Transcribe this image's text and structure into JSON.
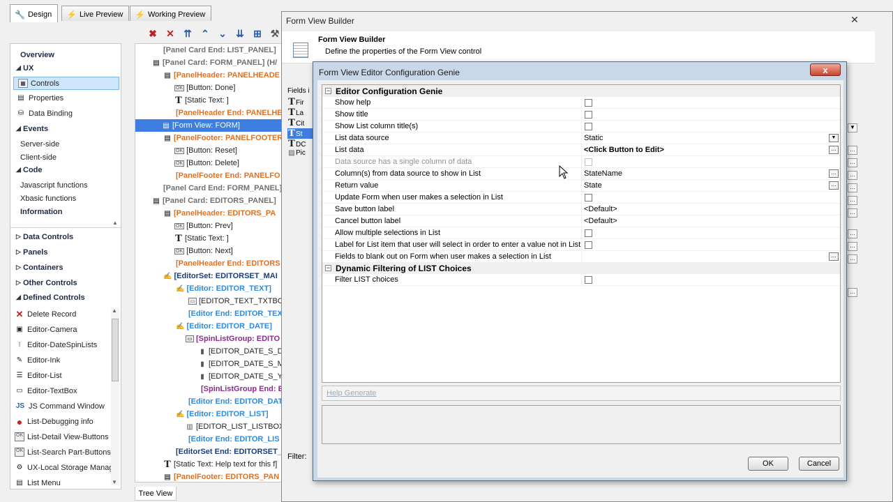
{
  "tabs": [
    {
      "label": "Design",
      "icon": "wrench-icon",
      "active": true
    },
    {
      "label": "Live Preview",
      "icon": "lightning-icon",
      "active": false
    },
    {
      "label": "Working Preview",
      "icon": "lightning-icon",
      "active": false
    }
  ],
  "toolbar": {
    "buttons": [
      "delete-x-icon",
      "delete-icon",
      "move-top-icon",
      "move-up-icon",
      "move-down-icon",
      "move-bottom-icon",
      "indent-icon",
      "wrench-icon"
    ]
  },
  "nav": {
    "overview": "Overview",
    "ux": "UX",
    "controls": "Controls",
    "properties": "Properties",
    "data_binding": "Data Binding",
    "events": "Events",
    "server_side": "Server-side",
    "client_side": "Client-side",
    "code": "Code",
    "js_functions": "Javascript functions",
    "xbasic_functions": "Xbasic functions",
    "information": "Information",
    "data_controls": "Data Controls",
    "panels": "Panels",
    "containers": "Containers",
    "other_controls": "Other Controls",
    "defined_controls": "Defined Controls",
    "defined_items": [
      "Delete Record",
      "Editor-Camera",
      "Editor-DateSpinLists",
      "Editor-Ink",
      "Editor-List",
      "Editor-TextBox",
      "JS Command Window",
      "List-Debugging info",
      "List-Detail View-Buttons",
      "List-Search Part-Buttons",
      "UX-Local Storage Manage",
      "List Menu"
    ]
  },
  "tree": {
    "nodes": [
      "[Panel Card End: LIST_PANEL]",
      "[Panel Card: FORM_PANEL]  (H/",
      "[PanelHeader: PANELHEADE",
      "[Button: Done]",
      "[Static Text: ]",
      "[PanelHeader End: PANELHE",
      "[Form View: FORM]",
      "[PanelFooter: PANELFOOTER",
      "[Button: Reset]",
      "[Button: Delete]",
      "[PanelFooter End: PANELFO",
      "[Panel Card End: FORM_PANEL]",
      "[Panel Card: EDITORS_PANEL]",
      "[PanelHeader: EDITORS_PA",
      "[Button: Prev]",
      "[Static Text: ]",
      "[Button: Next]",
      "[PanelHeader End: EDITORS",
      "[EditorSet: EDITORSET_MAI",
      "[Editor: EDITOR_TEXT]",
      "[EDITOR_TEXT_TXTBOX]",
      "[Editor End: EDITOR_TEX",
      "[Editor: EDITOR_DATE]",
      "[SpinListGroup: EDITO",
      "[EDITOR_DATE_S_DA",
      "[EDITOR_DATE_S_M",
      "[EDITOR_DATE_S_YE",
      "[SpinListGroup End: E",
      "[Editor End: EDITOR_DAT",
      "[Editor: EDITOR_LIST]",
      "[EDITOR_LIST_LISTBOX]",
      "[Editor End: EDITOR_LIS",
      "[EditorSet End: EDITORSET_",
      "[Static Text: Help text for this f]",
      "[PanelFooter: EDITORS_PAN"
    ],
    "tab_label": "Tree View"
  },
  "fvb": {
    "window_title": "Form View Builder",
    "header_title": "Form View Builder",
    "header_desc": "Define the properties of the Form View control",
    "fields_label": "Fields i",
    "fields": [
      "Fir",
      "La",
      "Cit",
      "St",
      "DC",
      "Pic"
    ],
    "filter_label": "Filter:"
  },
  "dialog": {
    "title": "Form View Editor Configuration Genie",
    "close": "x",
    "section1": "Editor Configuration Genie",
    "section2": "Dynamic Filtering of LIST Choices",
    "rows": [
      {
        "label": "Show help",
        "type": "check",
        "value": ""
      },
      {
        "label": "Show title",
        "type": "check",
        "value": ""
      },
      {
        "label": "Show List column title(s)",
        "type": "check",
        "value": ""
      },
      {
        "label": "List data source",
        "type": "dropdown",
        "value": "Static"
      },
      {
        "label": "List data",
        "type": "ellipsis-bold",
        "value": "<Click Button to Edit>"
      },
      {
        "label": "Data source has a single column of data",
        "type": "check-disabled",
        "value": ""
      },
      {
        "label": "Column(s) from data source to show in List",
        "type": "ellipsis",
        "value": "StateName"
      },
      {
        "label": "Return value",
        "type": "ellipsis",
        "value": "State"
      },
      {
        "label": "Update Form when user makes a selection in List",
        "type": "check",
        "value": ""
      },
      {
        "label": "Save button label",
        "type": "text",
        "value": "<Default>"
      },
      {
        "label": "Cancel button label",
        "type": "text",
        "value": "<Default>"
      },
      {
        "label": "Allow multiple selections in List",
        "type": "check",
        "value": ""
      },
      {
        "label": "Label for List item that user will select in order to enter a value not in List",
        "type": "check",
        "value": ""
      },
      {
        "label": "Fields to blank out on Form when user makes a selection in List",
        "type": "ellipsis-only",
        "value": ""
      }
    ],
    "rows2": [
      {
        "label": "Filter LIST choices",
        "type": "check",
        "value": ""
      }
    ],
    "help_generate": "Help Generate",
    "ok": "OK",
    "cancel": "Cancel"
  }
}
